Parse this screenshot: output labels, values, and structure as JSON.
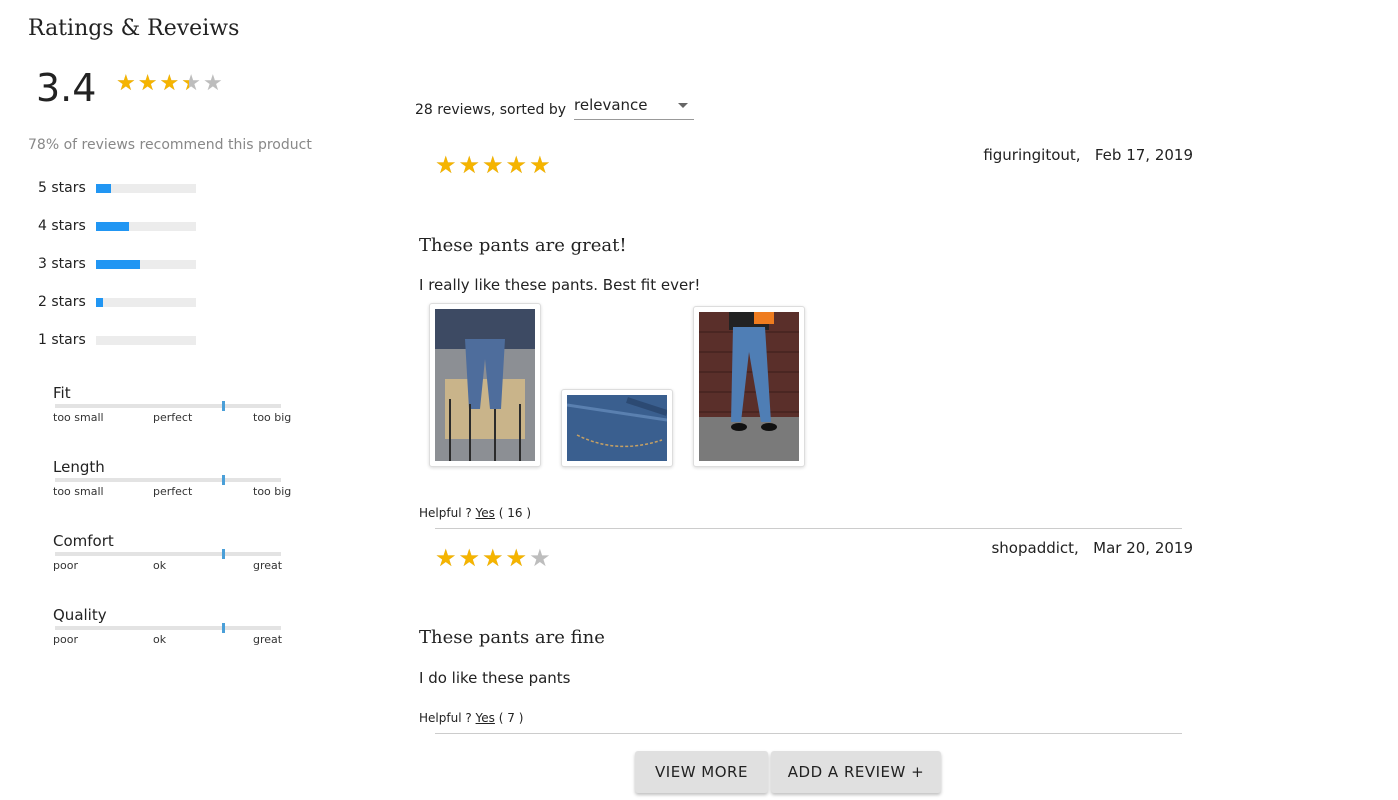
{
  "header": {
    "title": "Ratings & Reveiws"
  },
  "summary": {
    "average": "3.4",
    "average_value": 3.4,
    "recommend_text": "78% of reviews recommend this product",
    "breakdown": [
      {
        "label": "5 stars",
        "fraction": 0.15
      },
      {
        "label": "4 stars",
        "fraction": 0.33
      },
      {
        "label": "3 stars",
        "fraction": 0.44
      },
      {
        "label": "2 stars",
        "fraction": 0.07
      },
      {
        "label": "1 stars",
        "fraction": 0.0
      }
    ],
    "factors": [
      {
        "name": "Fit",
        "labels": [
          "too small",
          "perfect",
          "too big"
        ],
        "value": 0.74
      },
      {
        "name": "Length",
        "labels": [
          "too small",
          "perfect",
          "too big"
        ],
        "value": 0.74
      },
      {
        "name": "Comfort",
        "labels": [
          "poor",
          "ok",
          "great"
        ],
        "value": 0.74
      },
      {
        "name": "Quality",
        "labels": [
          "poor",
          "ok",
          "great"
        ],
        "value": 0.74
      }
    ]
  },
  "sort": {
    "prefix": "28 reviews, sorted by",
    "selected": "relevance"
  },
  "reviews": [
    {
      "rating": 5,
      "user": "figuringitout,",
      "date": "Feb 17, 2019",
      "title": "These pants are great!",
      "body": "I really like these pants. Best fit ever!",
      "helpful_label": "Helpful ?",
      "yes_label": "Yes",
      "count": "( 16 )",
      "photos": [
        "photo-hanging-jeans",
        "photo-denim-pocket",
        "photo-person-jeans"
      ]
    },
    {
      "rating": 4,
      "user": "shopaddict,",
      "date": "Mar 20, 2019",
      "title": "These pants are fine",
      "body": "I do like these pants",
      "helpful_label": "Helpful ?",
      "yes_label": "Yes",
      "count": "( 7 )",
      "photos": []
    }
  ],
  "actions": {
    "view_more": "VIEW MORE",
    "add_review": "ADD A REVIEW +"
  },
  "colors": {
    "star": "#f5b400",
    "star_empty": "#bdbdbd",
    "bar": "#2196f3",
    "marker": "#4a9fd8"
  }
}
